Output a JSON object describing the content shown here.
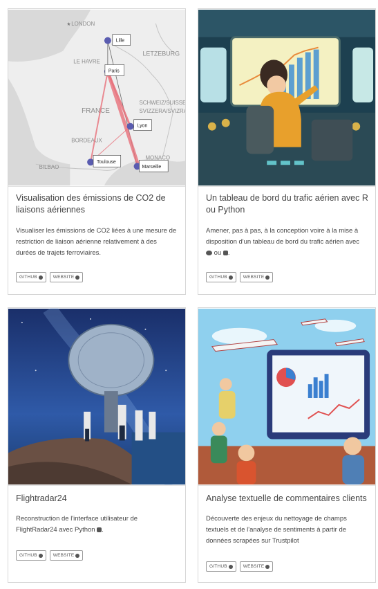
{
  "cards": [
    {
      "title": "Visualisation des émissions de CO2 de liaisons aériennes",
      "description": "Visualiser les émissions de CO2 liées à une mesure de restriction de liaison aérienne relativement à des durées de trajets ferroviaires.",
      "buttons": {
        "github": "GITHUB",
        "website": "WEBSITE"
      },
      "map": {
        "countries": [
          "LONDON",
          "LE HAVRE",
          "LETZEBURG",
          "FRANCE",
          "SCHWEIZ/SUISSE",
          "SVIZZERA/SVIZRA",
          "BORDEAUX",
          "BILBAO",
          "MONACO"
        ],
        "cities": [
          "Lille",
          "Paris",
          "Lyon",
          "Toulouse",
          "Marseille"
        ]
      }
    },
    {
      "title": "Un tableau de bord du trafic aérien avec R ou Python",
      "description": "Amener, pas à pas, à la conception voire à la mise à disposition d'un tableau de bord du trafic aérien avec",
      "description_tail": "ou",
      "description_end": ".",
      "buttons": {
        "github": "GITHUB",
        "website": "WEBSITE"
      }
    },
    {
      "title": "Flightradar24",
      "description": "Reconstruction de l'interface utilisateur de FlightRadar24 avec Python",
      "description_end": ".",
      "buttons": {
        "github": "GITHUB",
        "website": "WEBSITE"
      }
    },
    {
      "title": "Analyse textuelle de commentaires clients",
      "description": "Découverte des enjeux du nettoyage de champs textuels et de l'analyse de sentiments à partir de données scrapées sur Trustpilot",
      "buttons": {
        "github": "GITHUB",
        "website": "WEBSITE"
      }
    }
  ],
  "colors": {
    "accent_route": "#e8707a",
    "marker": "#5a5cb0",
    "border": "#d6d6d6"
  },
  "icons": [
    "github-icon",
    "website-icon",
    "r-logo-icon",
    "python-logo-icon"
  ]
}
